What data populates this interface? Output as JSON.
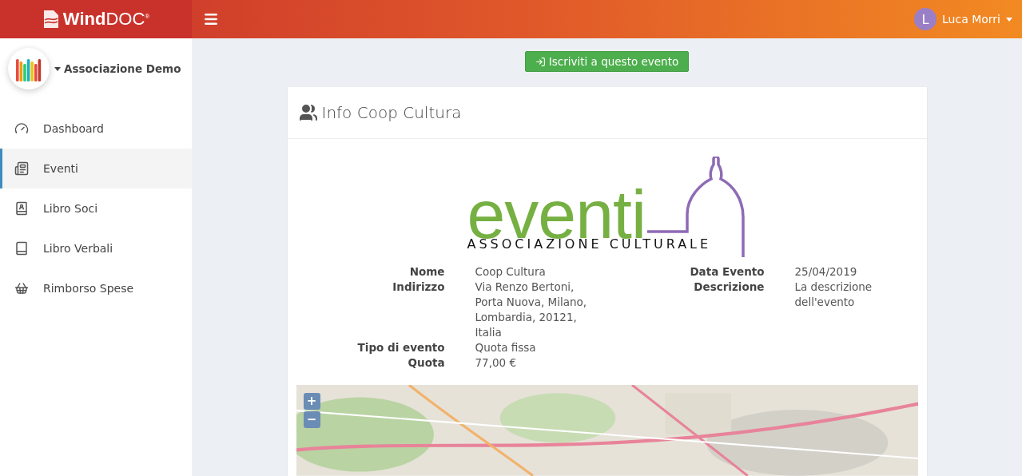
{
  "header": {
    "brand_bold": "Wind",
    "brand_light": "DOC",
    "brand_mark": "®",
    "user": {
      "initial": "L",
      "name": "Luca Morri"
    }
  },
  "sidebar": {
    "organization": "Associazione Demo",
    "items": [
      {
        "label": "Dashboard",
        "selected": false
      },
      {
        "label": "Eventi",
        "selected": true
      },
      {
        "label": "Libro Soci",
        "selected": false
      },
      {
        "label": "Libro Verbali",
        "selected": false
      },
      {
        "label": "Rimborso Spese",
        "selected": false
      }
    ]
  },
  "action_button": "Iscriviti a questo evento",
  "card": {
    "title": "Info Coop Cultura",
    "logo": {
      "word": "eventi",
      "tagline": "ASSOCIAZIONE CULTURALE"
    },
    "details_left": [
      {
        "label": "Nome",
        "value": "Coop Cultura"
      },
      {
        "label": "Indirizzo",
        "value": "Via Renzo Bertoni, Porta Nuova, Milano, Lombardia, 20121, Italia"
      },
      {
        "label": "Tipo di evento",
        "value": "Quota fissa"
      },
      {
        "label": "Quota",
        "value": "77,00 €"
      }
    ],
    "details_right": [
      {
        "label": "Data Evento",
        "value": "25/04/2019"
      },
      {
        "label": "Descrizione",
        "value": "La descrizione dell'evento"
      }
    ],
    "map": {
      "zoom_in": "+",
      "zoom_out": "−"
    }
  }
}
